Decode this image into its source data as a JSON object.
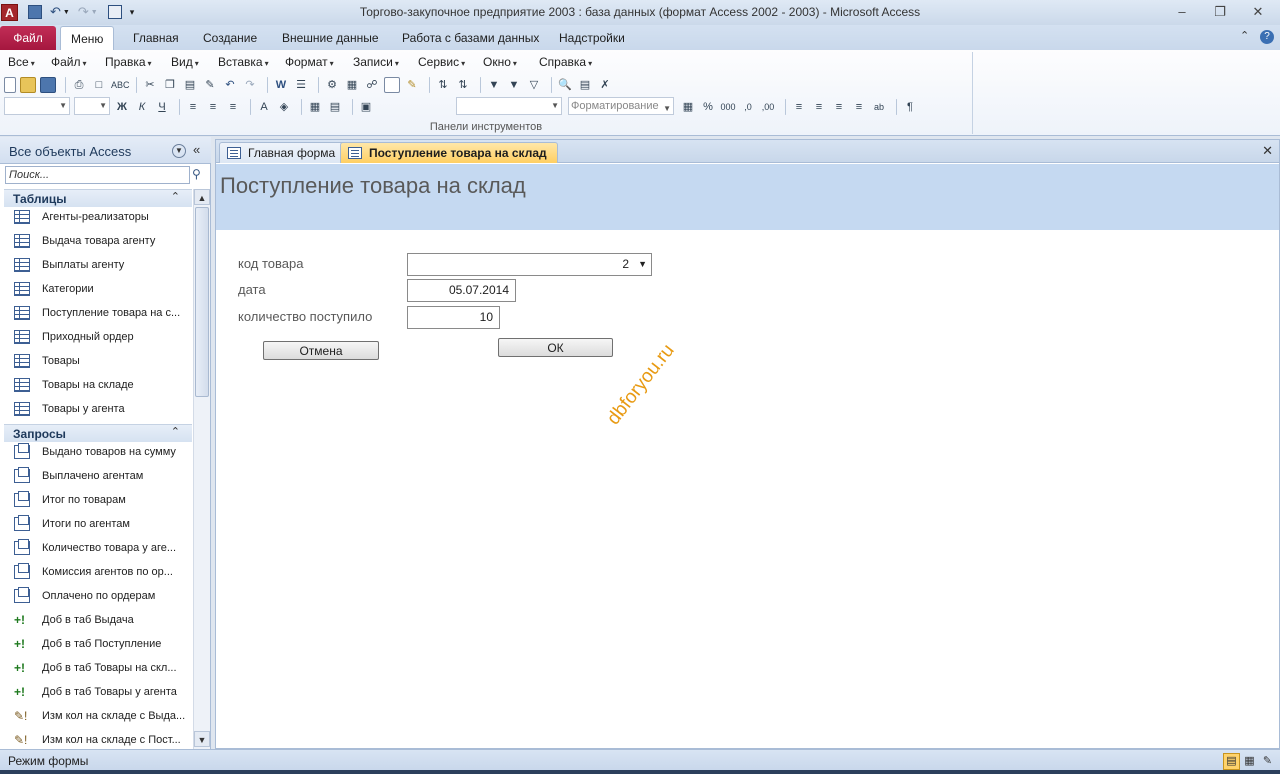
{
  "window": {
    "title": "Торгово-закупочное предприятие 2003 : база данных (формат Access 2002 - 2003)  -  Microsoft Access",
    "app_icon_letter": "A"
  },
  "ribbon": {
    "file_tab": "Файл",
    "tabs": [
      "Меню",
      "Главная",
      "Создание",
      "Внешние данные",
      "Работа с базами данных",
      "Надстройки"
    ],
    "active_tab": "Меню",
    "menus": [
      "Все",
      "Файл",
      "Правка",
      "Вид",
      "Вставка",
      "Формат",
      "Записи",
      "Сервис",
      "Окно",
      "Справка"
    ],
    "format_combo": "Форматирование",
    "group_label": "Панели инструментов"
  },
  "navpane": {
    "title": "Все объекты Access",
    "search_placeholder": "Поиск...",
    "groups": [
      {
        "name": "Таблицы",
        "items": [
          "Агенты-реализаторы",
          "Выдача товара агенту",
          "Выплаты агенту",
          "Категории",
          "Поступление товара на с...",
          "Приходный ордер",
          "Товары",
          "Товары на складе",
          "Товары у агента"
        ]
      },
      {
        "name": "Запросы",
        "items": [
          "Выдано товаров на сумму",
          "Выплачено агентам",
          "Итог по товарам",
          "Итоги по агентам",
          "Количество товара у аге...",
          "Комиссия агентов по ор...",
          "Оплачено по ордерам",
          "Доб в таб Выдача",
          "Доб в таб Поступление",
          "Доб в таб Товары на скл...",
          "Доб в таб Товары у агента",
          "Изм кол на складе с Выда...",
          "Изм кол на складе с Пост..."
        ]
      }
    ]
  },
  "doc": {
    "tabs": [
      "Главная форма",
      "Поступление товара на склад"
    ],
    "active_tab": "Поступление товара на склад"
  },
  "form": {
    "title": "Поступление товара на склад",
    "fields": {
      "product_code_label": "код товара",
      "product_code_value": "2",
      "date_label": "дата",
      "date_value": "05.07.2014",
      "qty_label": "количество поступило",
      "qty_value": "10"
    },
    "buttons": {
      "cancel": "Отмена",
      "ok": "ОК"
    },
    "watermark": "dbforyou.ru"
  },
  "statusbar": {
    "mode": "Режим формы"
  },
  "colors": {
    "file_tab": "#b81f4b",
    "form_header": "#c5d9f1",
    "active_doc_tab": "#ffcf63",
    "watermark": "#e89a12"
  }
}
